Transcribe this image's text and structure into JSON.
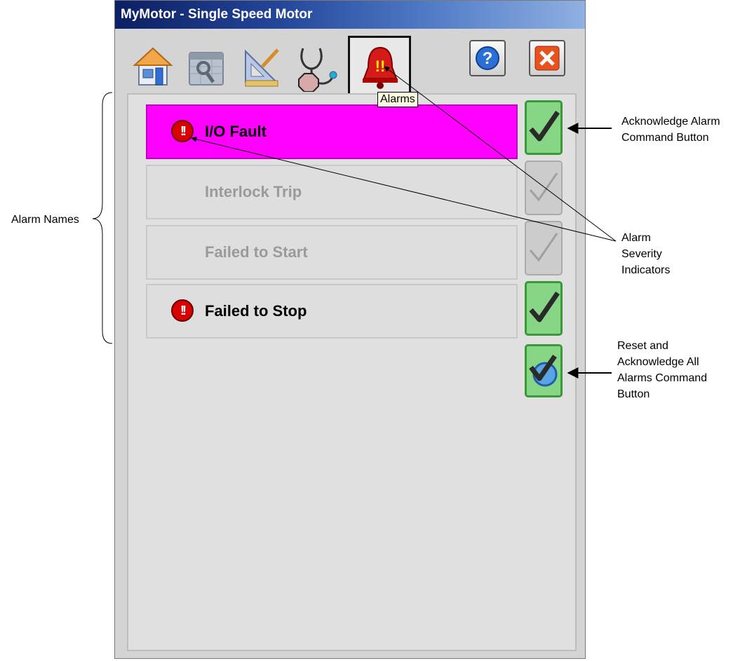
{
  "window": {
    "title": "MyMotor - Single Speed Motor"
  },
  "toolbar": {
    "tabs": [
      {
        "name": "home",
        "icon": "home-icon"
      },
      {
        "name": "maintenance",
        "icon": "maintenance-icon"
      },
      {
        "name": "engineering",
        "icon": "engineering-icon"
      },
      {
        "name": "diagnostics",
        "icon": "diagnostics-icon"
      },
      {
        "name": "alarms",
        "icon": "alarm-bell-icon",
        "selected": true
      }
    ],
    "help_icon": "help-icon",
    "close_icon": "close-icon",
    "tooltip": "Alarms"
  },
  "alarms": [
    {
      "label": "I/O Fault",
      "active": true,
      "severity_indicator": true
    },
    {
      "label": "Interlock Trip",
      "active": false,
      "severity_indicator": false
    },
    {
      "label": "Failed to Start",
      "active": false,
      "severity_indicator": false
    },
    {
      "label": "Failed to Stop",
      "active": false,
      "severity_indicator": true
    }
  ],
  "callouts": {
    "alarm_names": "Alarm Names",
    "acknowledge_alarm": [
      "Acknowledge Alarm",
      "Command Button"
    ],
    "severity_indicators": [
      "Alarm",
      "Severity",
      "Indicators"
    ],
    "reset_acknowledge_all": [
      "Reset and",
      "Acknowledge All",
      "Alarms Command",
      "Button"
    ]
  },
  "colors": {
    "active_alarm_bg": "#ff00ff",
    "severity_red": "#d80000",
    "ack_green": "#86d686",
    "panel_bg": "#d4d4d4"
  }
}
